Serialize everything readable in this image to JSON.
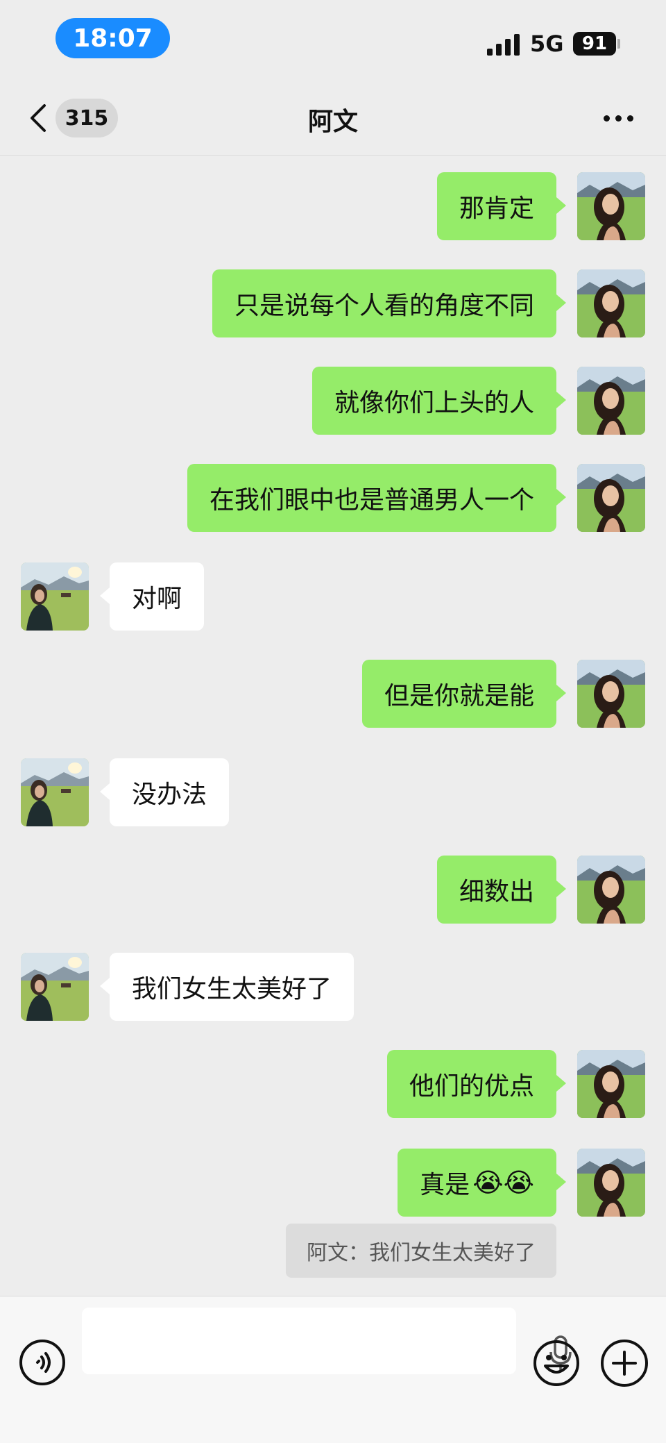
{
  "status_bar": {
    "time": "18:07",
    "network": "5G",
    "battery": "91"
  },
  "nav": {
    "unread_count": "315",
    "title": "阿文"
  },
  "messages": [
    {
      "side": "me",
      "text": "那肯定"
    },
    {
      "side": "me",
      "text": "只是说每个人看的角度不同"
    },
    {
      "side": "me",
      "text": "就像你们上头的人"
    },
    {
      "side": "me",
      "text": "在我们眼中也是普通男人一个"
    },
    {
      "side": "them",
      "text": "对啊"
    },
    {
      "side": "me",
      "text": "但是你就是能"
    },
    {
      "side": "them",
      "text": "没办法"
    },
    {
      "side": "me",
      "text": "细数出"
    },
    {
      "side": "them",
      "text": "我们女生太美好了"
    },
    {
      "side": "me",
      "text": "他们的优点"
    },
    {
      "side": "me",
      "text": "真是",
      "emoji": "😭😭"
    }
  ],
  "quote": {
    "text": "阿文：我们女生太美好了"
  },
  "colors": {
    "my_bubble": "#95ec69",
    "their_bubble": "#ffffff",
    "background": "#ededed",
    "time_pill": "#1a8cff"
  },
  "icons": [
    "back-icon",
    "more-icon",
    "voice-icon",
    "mic-icon",
    "emoji-icon",
    "plus-icon"
  ]
}
